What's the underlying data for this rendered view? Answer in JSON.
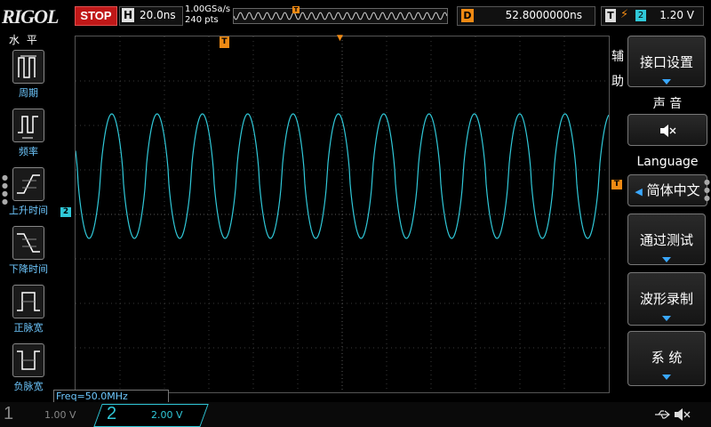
{
  "topbar": {
    "brand": "RIGOL",
    "run_state": "STOP",
    "horizontal_label": "H",
    "timebase": "20.0ns",
    "sample_rate": "1.00GSa/s",
    "points": "240  pts",
    "delay_label": "D",
    "delay_value": "52.8000000ns",
    "trigger_label": "T",
    "trigger_edge_symbol": "⚡",
    "trigger_channel": "2",
    "trigger_level": "1.20 V"
  },
  "measure_panel": {
    "title": "水  平",
    "items": [
      {
        "label": "周期",
        "icon": "period-icon"
      },
      {
        "label": "频率",
        "icon": "frequency-icon"
      },
      {
        "label": "上升时间",
        "icon": "rise-time-icon"
      },
      {
        "label": "下降时间",
        "icon": "fall-time-icon"
      },
      {
        "label": "正脉宽",
        "icon": "positive-width-icon"
      },
      {
        "label": "负脉宽",
        "icon": "negative-width-icon"
      }
    ]
  },
  "waveform": {
    "channel": "2",
    "frequency_readout": "Freq=50.0MHz",
    "cycles_on_screen": 12,
    "color": "#30c8d8",
    "trigger_marker": "T"
  },
  "utility_menu": {
    "aux_label": "辅助",
    "interface_settings": "接口设置",
    "sound_title": "声  音",
    "sound_value_icon": "speaker-mute-icon",
    "language_title": "Language",
    "language_value": "简体中文",
    "pass_fail": "通过测试",
    "waveform_record": "波形录制",
    "system": "系  统"
  },
  "channels": {
    "ch1_number": "1",
    "ch1_scale": "1.00 V",
    "ch2_number": "2",
    "ch2_scale": "2.00 V"
  },
  "colors": {
    "ch2": "#30c8d8",
    "trigger": "#f08a14",
    "stop": "#c01818",
    "menu_arrow": "#3aa8ff"
  }
}
